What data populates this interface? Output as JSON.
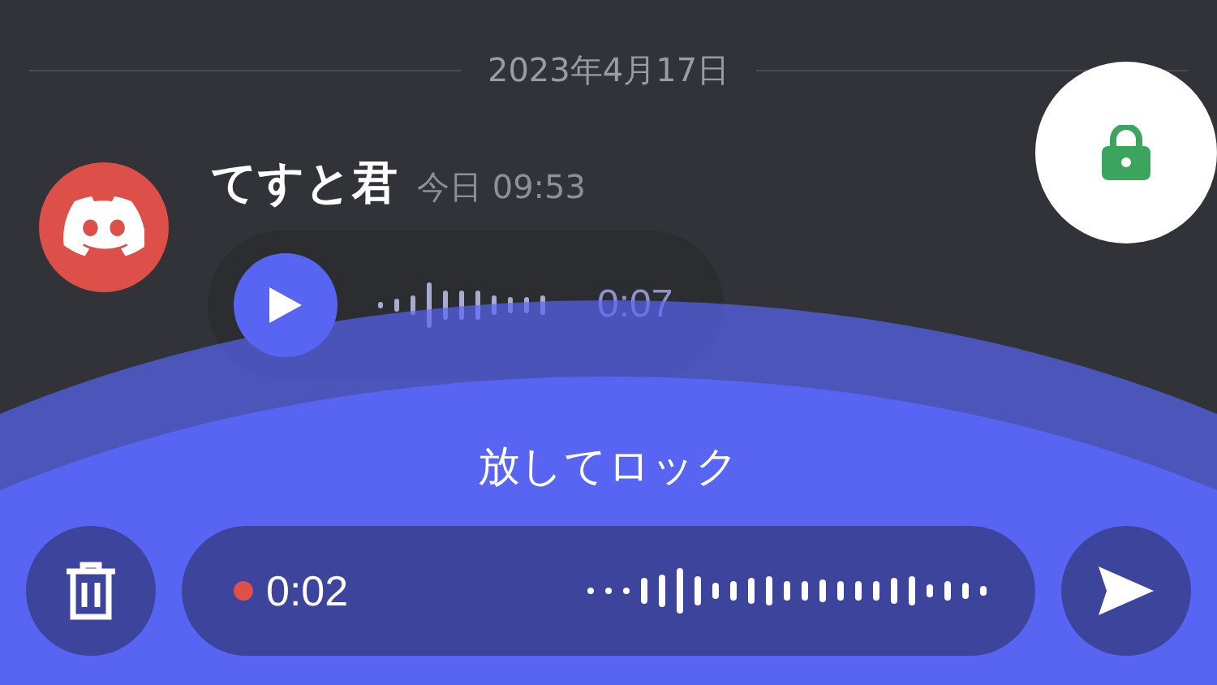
{
  "date_divider": "2023年4月17日",
  "message": {
    "author": "てすと君",
    "timestamp": "今日 09:53",
    "voice_message": {
      "duration": "0:07"
    }
  },
  "recorder": {
    "hint": "放してロック",
    "elapsed": "0:02",
    "recording": true
  }
}
